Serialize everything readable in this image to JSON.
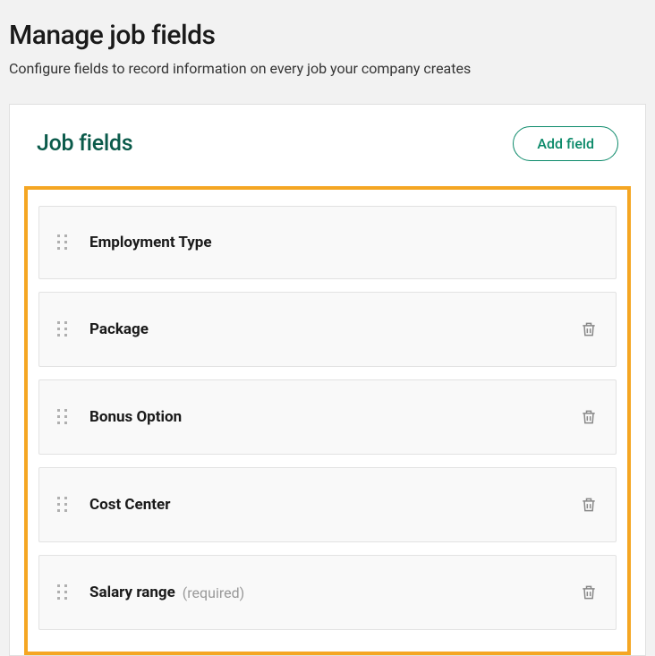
{
  "page": {
    "title": "Manage job fields",
    "subtitle": "Configure fields to record information on every job your company creates"
  },
  "card": {
    "title": "Job fields",
    "add_button": "Add field"
  },
  "fields": [
    {
      "label": "Employment Type",
      "deletable": false,
      "required": false
    },
    {
      "label": "Package",
      "deletable": true,
      "required": false
    },
    {
      "label": "Bonus Option",
      "deletable": true,
      "required": false
    },
    {
      "label": "Cost Center",
      "deletable": true,
      "required": false
    },
    {
      "label": "Salary range",
      "deletable": true,
      "required": true
    }
  ],
  "required_text": "(required)"
}
